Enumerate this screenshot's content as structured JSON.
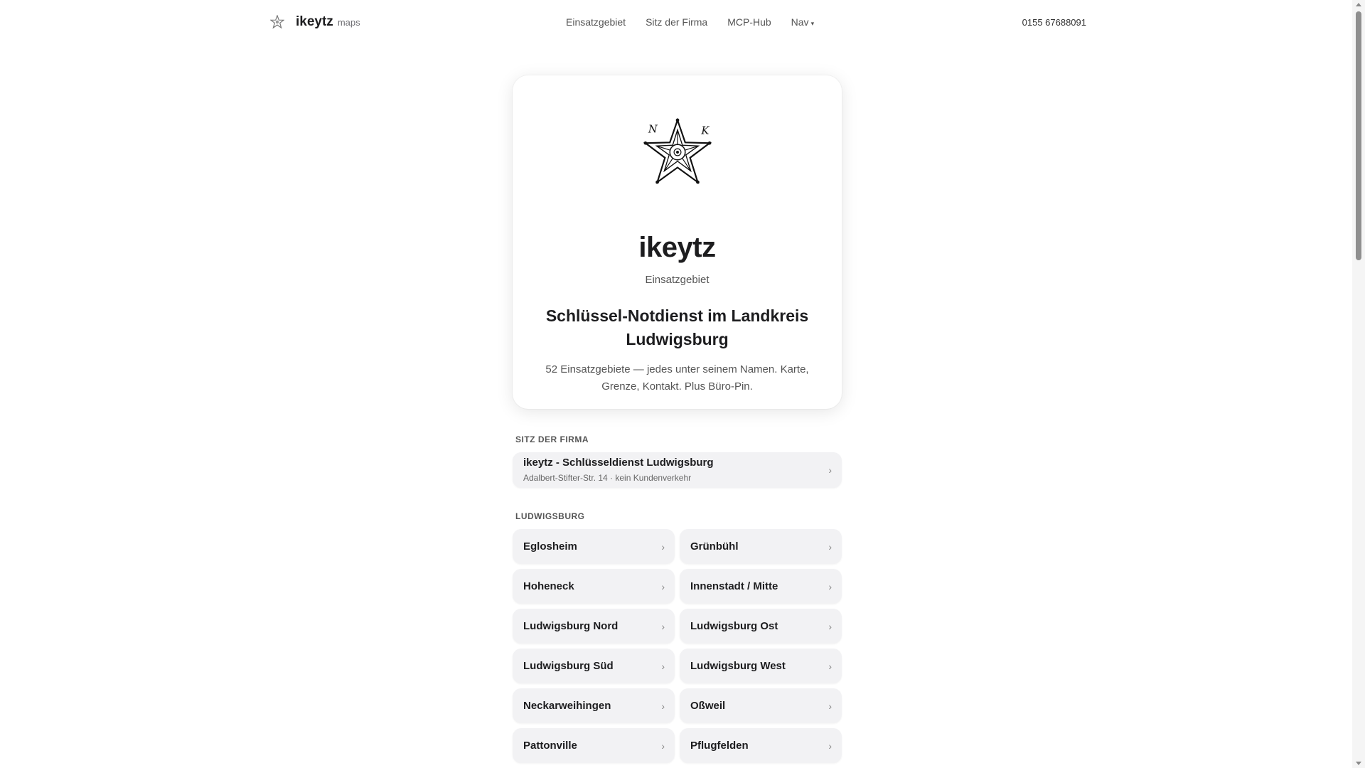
{
  "header": {
    "brand_name": "ikeytz",
    "brand_sub": "maps",
    "nav": [
      "Einsatzgebiet",
      "Sitz der Firma",
      "MCP-Hub",
      "Nav"
    ],
    "nav_caret": "▾",
    "phone": "0155 67688091"
  },
  "hero": {
    "logo_icon": "star-ornament-icon",
    "logo_letters": [
      "N",
      "K"
    ],
    "title": "ikeytz",
    "subtitle": "Einsatzgebiet",
    "heading": "Schlüssel-Notdienst im Landkreis Ludwigsburg",
    "description": "52 Einsatzgebiete — jedes unter seinem Namen. Karte, Grenze, Kontakt. Plus Büro-Pin."
  },
  "hq": {
    "label": "SITZ DER FIRMA",
    "name": "ikeytz - Schlüsseldienst Ludwigsburg",
    "address": "Adalbert-Stifter-Str. 14 · kein Kundenverkehr",
    "chevron": "›"
  },
  "district": {
    "label": "LUDWIGSBURG",
    "chevron": "›",
    "items": [
      "Eglosheim",
      "Grünbühl",
      "Hoheneck",
      "Innenstadt / Mitte",
      "Ludwigsburg Nord",
      "Ludwigsburg Ost",
      "Ludwigsburg Süd",
      "Ludwigsburg West",
      "Neckarweihingen",
      "Oßweil",
      "Pattonville",
      "Pflugfelden"
    ]
  },
  "colors": {
    "tile_bg": "#f2f2f4",
    "text": "#1d1d1f",
    "muted": "#555555"
  }
}
